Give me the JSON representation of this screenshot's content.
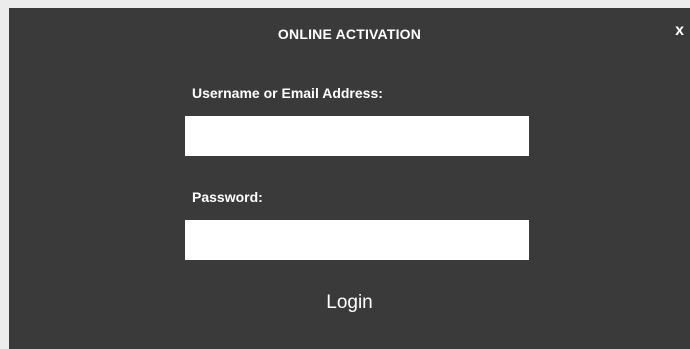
{
  "dialog": {
    "title": "ONLINE ACTIVATION",
    "close_label": "x"
  },
  "form": {
    "username_label": "Username or Email Address:",
    "username_value": "",
    "password_label": "Password:",
    "password_value": "",
    "login_label": "Login"
  }
}
